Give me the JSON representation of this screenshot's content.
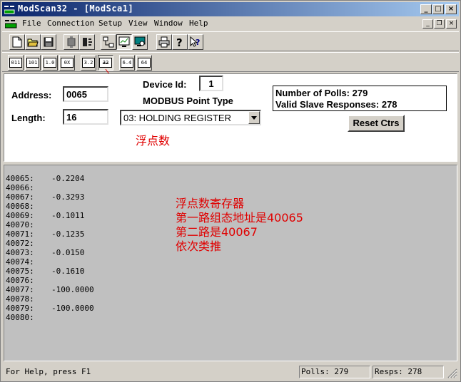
{
  "window": {
    "title": "ModScan32 - [ModSca1]",
    "controls": {
      "minimize": "_",
      "maximize": "□",
      "close": "×"
    }
  },
  "menu": {
    "items": [
      "File",
      "Connection",
      "Setup",
      "View",
      "Window",
      "Help"
    ],
    "mdi": {
      "minimize": "_",
      "restore": "❐",
      "close": "×"
    }
  },
  "toolbar2": {
    "formats": [
      "011",
      "101",
      "1.0",
      "0X",
      "3.2",
      "32",
      "6.4",
      "64"
    ]
  },
  "config": {
    "address_label": "Address:",
    "address_value": "0065",
    "length_label": "Length:",
    "length_value": "16",
    "device_id_label": "Device Id:",
    "device_id_value": "1",
    "point_type_label": "MODBUS Point Type",
    "point_type_value": "03: HOLDING REGISTER",
    "polls_text": "Number of Polls: 279",
    "responses_text": "Valid Slave Responses: 278",
    "reset_label": "Reset Ctrs",
    "annotation": "浮点数"
  },
  "data_rows": [
    {
      "addr": "40065:",
      "value": "-0.2204"
    },
    {
      "addr": "40066:",
      "value": ""
    },
    {
      "addr": "40067:",
      "value": "-0.3293"
    },
    {
      "addr": "40068:",
      "value": ""
    },
    {
      "addr": "40069:",
      "value": "-0.1011"
    },
    {
      "addr": "40070:",
      "value": ""
    },
    {
      "addr": "40071:",
      "value": "-0.1235"
    },
    {
      "addr": "40072:",
      "value": ""
    },
    {
      "addr": "40073:",
      "value": "-0.0150"
    },
    {
      "addr": "40074:",
      "value": ""
    },
    {
      "addr": "40075:",
      "value": "-0.1610"
    },
    {
      "addr": "40076:",
      "value": ""
    },
    {
      "addr": "40077:",
      "value": "-100.0000"
    },
    {
      "addr": "40078:",
      "value": ""
    },
    {
      "addr": "40079:",
      "value": "-100.0000"
    },
    {
      "addr": "40080:",
      "value": ""
    }
  ],
  "data_annotation": [
    "浮点数寄存器",
    "第一路组态地址是40065",
    "第二路是40067",
    "依次类推"
  ],
  "status": {
    "help": "For Help, press F1",
    "polls": "Polls: 279",
    "resps": "Resps: 278"
  },
  "colors": {
    "annotation": "#e00000",
    "title_start": "#0a246a",
    "title_end": "#a6caf0",
    "data_bg": "#c0c0c0"
  }
}
